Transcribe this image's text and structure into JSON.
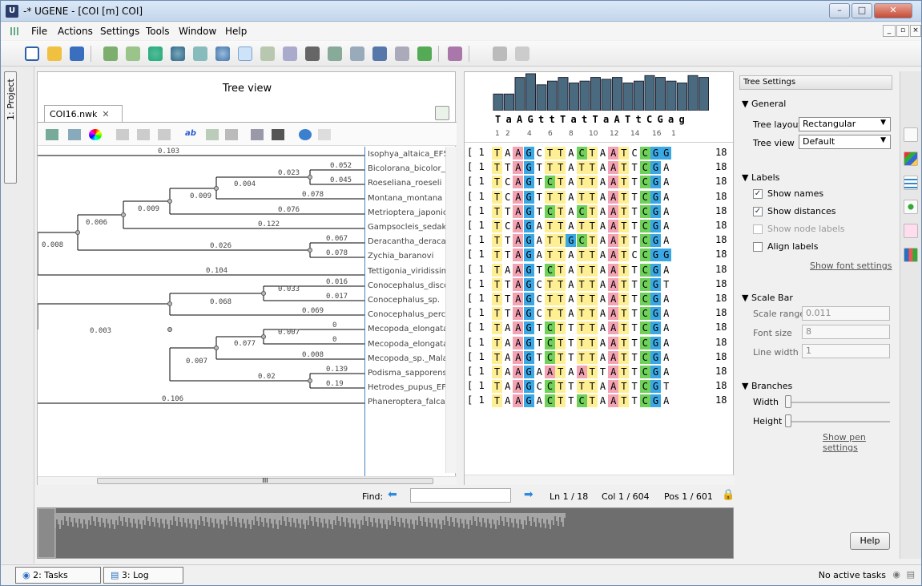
{
  "window": {
    "title": "-* UGENE - [COI [m] COI]",
    "app_icon": "U"
  },
  "menu": [
    "File",
    "Actions",
    "Settings",
    "Tools",
    "Window",
    "Help"
  ],
  "side_tab": "1: Project",
  "tree": {
    "panel_title": "Tree view",
    "tab_label": "COI16.nwk",
    "names": [
      "Isophya_altaica_EF54",
      "Bicolorana_bicolor_EF",
      "Roeseliana_roeseli",
      "Montana_montana",
      "Metrioptera_japonica",
      "Gampsocleis_sedakov",
      "Deracantha_deracant",
      "Zychia_baranovi",
      "Tettigonia_viridissima",
      "Conocephalus_discolo",
      "Conocephalus_sp.",
      "Conocephalus_percau",
      "Mecopoda_elongata_",
      "Mecopoda_elongata_",
      "Mecopoda_sp._Mala",
      "Podisma_sapporensis",
      "Hetrodes_pupus_EF5",
      "Phaneroptera_falcata"
    ],
    "distances": [
      "0.103",
      "0.052",
      "0.023",
      "0.045",
      "0.004",
      "0.078",
      "0.009",
      "0.009",
      "0.076",
      "0.006",
      "0.122",
      "0.067",
      "0.008",
      "0.026",
      "0.078",
      "0.104",
      "0.016",
      "0.033",
      "0.017",
      "0.068",
      "0.069",
      "0.003",
      "0",
      "0.007",
      "0",
      "0.077",
      "0.008",
      "0.007",
      "0.139",
      "0.02",
      "0.19",
      "0.106"
    ]
  },
  "alignment": {
    "consensus": "TaAGttTatTaATtCGag",
    "ruler": [
      "1",
      "2",
      "4",
      "6",
      "8",
      "10",
      "12",
      "14",
      "16",
      "1"
    ],
    "row_start": "1",
    "row_end": "18",
    "rows": [
      "TAAGCTTACTAATCCGG",
      "TTAGTTTATTAATTCGA",
      "TCAGTCTATTAATTCGA",
      "TCAGTTTATTAATTCGA",
      "TTAGTCTACTAATTCGA",
      "TCAGATTATTAATTCGA",
      "TTAGATTGCTAATTCGA",
      "TTAGATTATTAATCCGG",
      "TAAGTCTATTAATTCGA",
      "TTAGCTTATTAATTCGT",
      "TTAGCTTATTAATTCGA",
      "TTAGCTTATTAATTCGA",
      "TAAGTCTTTTAATTCGA",
      "TAAGTCTTTTAATTCGA",
      "TAAGTCTTTTAATTCGA",
      "TAAGAATAATTATTCGA",
      "TAAGCCTTTTAATTCGT",
      "TAAGACTTCTAATTCGA"
    ],
    "colors": {
      "A": "#f4a3b4",
      "T": "#ffef94",
      "G": "#3aa8e4",
      "C": "#6fd05a"
    }
  },
  "find": {
    "label": "Find:",
    "value": "",
    "ln": "Ln 1 / 18",
    "col": "Col 1 / 604",
    "pos": "Pos 1 / 601"
  },
  "settings": {
    "header": "Tree Settings",
    "general": "General",
    "tree_layout_label": "Tree layout",
    "tree_layout_value": "Rectangular",
    "tree_view_label": "Tree view",
    "tree_view_value": "Default",
    "labels": "Labels",
    "show_names": "Show names",
    "show_distances": "Show distances",
    "show_node_labels": "Show node labels",
    "align_labels": "Align labels",
    "show_font_settings": "Show font settings",
    "scale_bar": "Scale Bar",
    "scale_range_label": "Scale range",
    "scale_range_value": "0.011",
    "font_size_label": "Font size",
    "font_size_value": "8",
    "line_width_label": "Line width",
    "line_width_value": "1",
    "branches": "Branches",
    "width_label": "Width",
    "height_label": "Height",
    "show_pen_settings": "Show pen settings",
    "help": "Help"
  },
  "status": {
    "tasks": "2: Tasks",
    "log": "3: Log",
    "right": "No active tasks"
  }
}
